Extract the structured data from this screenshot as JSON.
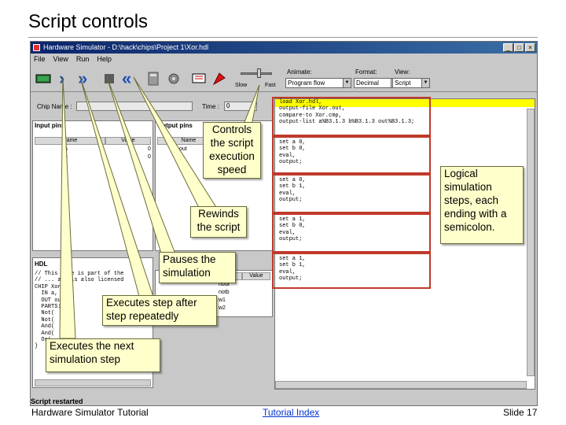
{
  "slide": {
    "title": "Script controls",
    "footer_left": "Hardware Simulator Tutorial",
    "footer_link": "Tutorial Index",
    "footer_right": "Slide 17"
  },
  "window": {
    "title": "Hardware Simulator - D:\\hack\\chips\\Project 1\\Xor.hdl",
    "menu": [
      "File",
      "View",
      "Run",
      "Help"
    ],
    "toolbar": {
      "slow_label": "Slow",
      "fast_label": "Fast",
      "animate_label": "Animate:",
      "animate_value": "Program flow",
      "format_label": "Format:",
      "format_value": "Decimal",
      "view_label": "View:",
      "view_value": "Script"
    },
    "chip_name_label": "Chip Name :",
    "time_label": "Time :",
    "time_value": "0",
    "input_pins": {
      "title": "Input pins",
      "headers": [
        "Name",
        "Value"
      ],
      "rows": [
        {
          "name": "a",
          "value": "0"
        },
        {
          "name": "b",
          "value": "0"
        }
      ]
    },
    "output_pins": {
      "title": "Output pins",
      "headers": [
        "Name"
      ],
      "rows": [
        {
          "name": "out"
        }
      ]
    },
    "hdl": {
      "title": "HDL",
      "lines": [
        "// This file is part of the",
        "// ... and is also licensed",
        "CHIP Xor {",
        "  IN a, b;",
        "  OUT out;",
        "  PARTS:",
        "  Not(",
        "  Not(",
        "  And(",
        "  And(",
        "  Or(",
        "}"
      ]
    },
    "internal": {
      "headers": [
        "Name",
        "Value"
      ],
      "rows": [
        {
          "name": "nota",
          "value": "0"
        },
        {
          "name": "notb",
          "value": "0"
        },
        {
          "name": "w1",
          "value": "0"
        },
        {
          "name": "w2",
          "value": "0"
        }
      ]
    },
    "script": {
      "blocks": [
        [
          "load Xor.hdl,",
          "output-file Xor.out,",
          "compare-to Xor.cmp,",
          "output-list a%B3.1.3 b%B3.1.3 out%B3.1.3;"
        ],
        [
          "set a 0,",
          "set b 0,",
          "eval,",
          "output;"
        ],
        [
          "set a 0,",
          "set b 1,",
          "eval,",
          "output;"
        ],
        [
          "set a 1,",
          "set b 0,",
          "eval,",
          "output;"
        ],
        [
          "set a 1,",
          "set b 1,",
          "eval,",
          "output;"
        ]
      ]
    },
    "status": "Script restarted"
  },
  "callouts": {
    "speed": "Controls\nthe script\nexecution\nspeed",
    "logical": "Logical\nsimulation\nsteps, each\nending with a\nsemicolon.",
    "rewind": "Rewinds\nthe script",
    "pause": "Pauses the\nsimulation",
    "step_repeat": "Executes step after\nstep repeatedly",
    "step_single": "Executes the next\nsimulation step"
  },
  "colors": {
    "callout_fill": "#ffffcc",
    "highlight": "#ffff00",
    "frame_red": "#c0392b",
    "control_blue": "#1d4fb8"
  }
}
